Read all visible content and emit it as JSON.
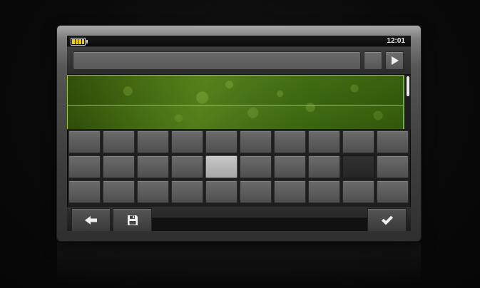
{
  "status_bar": {
    "battery_level": 1.0,
    "time": "12:01"
  },
  "input_row": {
    "text_value": "",
    "blank_button_icon": "none",
    "play_button_icon": "play-icon"
  },
  "list": {
    "rows": 2,
    "selected_row": 1,
    "scroll_position": 0.0
  },
  "keypad": {
    "rows": 3,
    "columns": 10,
    "highlighted_key": {
      "row": 2,
      "col": 5
    },
    "disabled_key": {
      "row": 2,
      "col": 9
    }
  },
  "toolbar": {
    "back_icon": "back-arrow-icon",
    "save_icon": "floppy-disk-icon",
    "confirm_icon": "checkmark-icon"
  },
  "colors": {
    "battery": "#f0d000",
    "accent_green": "#9ac13a",
    "key": "#5e5e5e",
    "key_highlight": "#b8b8b8"
  }
}
